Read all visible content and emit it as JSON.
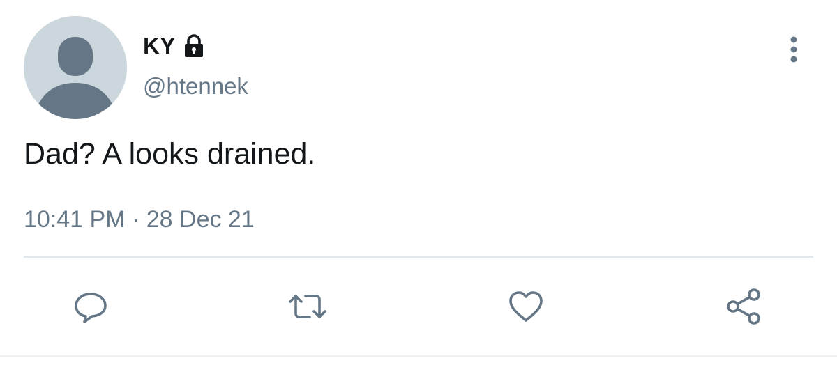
{
  "tweet": {
    "display_name": "KY",
    "handle": "@htennek",
    "text": "Dad? A looks drained.",
    "timestamp": "10:41 PM · 28 Dec 21",
    "protected_icon": "lock-icon"
  },
  "actions": [
    {
      "name": "reply",
      "icon": "comment-icon"
    },
    {
      "name": "retweet",
      "icon": "retweet-icon"
    },
    {
      "name": "like",
      "icon": "heart-icon"
    },
    {
      "name": "share",
      "icon": "share-icon"
    }
  ],
  "colors": {
    "primary_text": "#14171a",
    "secondary_text": "#657786",
    "avatar_bg": "#ccd6dd",
    "avatar_figure": "#657786",
    "divider": "#e1e8ed"
  }
}
